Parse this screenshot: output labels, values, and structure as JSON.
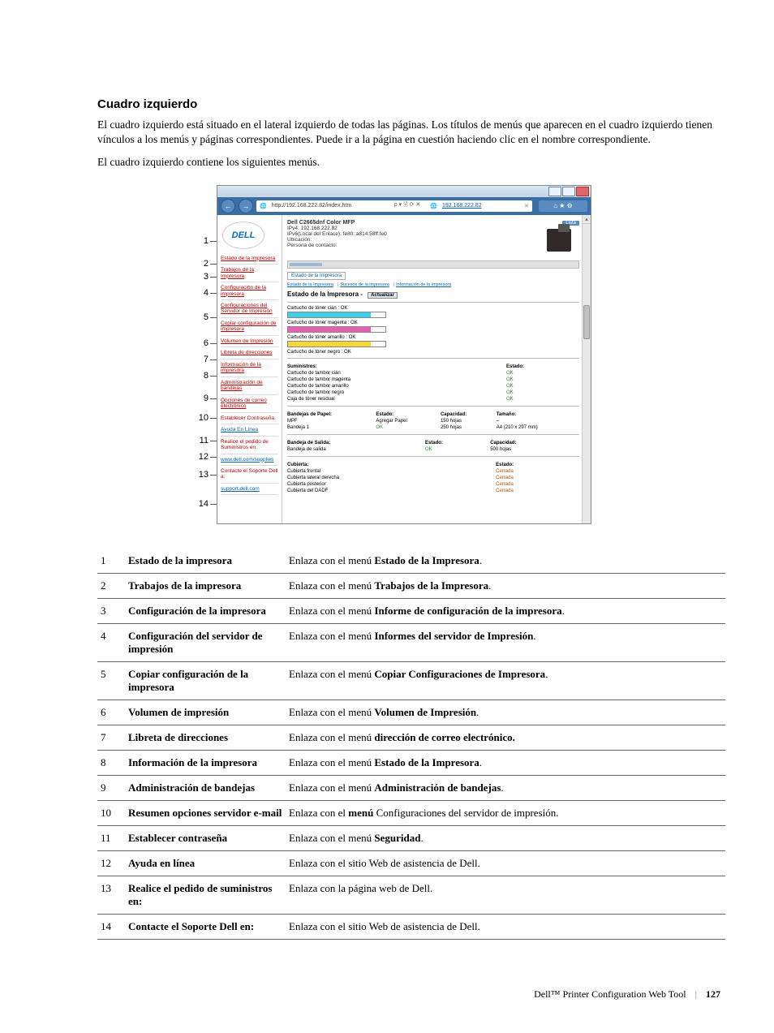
{
  "heading": "Cuadro izquierdo",
  "intro1": "El cuadro izquierdo está situado en el lateral izquierdo de todas las páginas. Los títulos de menús que aparecen en el cuadro izquierdo tienen vínculos a los menús y páginas correspondientes. Puede ir a la página en cuestión haciendo clic en el nombre correspondiente.",
  "intro2": "El cuadro izquierdo contiene los siguientes menús.",
  "callouts": [
    "1",
    "2",
    "3",
    "4",
    "5",
    "6",
    "7",
    "8",
    "9",
    "10",
    "11",
    "12",
    "13",
    "14"
  ],
  "browser": {
    "url": "http://192.168.222.82/index.htm",
    "searchhint": "ρ ▾ 🗟 ⟳ ✕",
    "tabtitle": "192.168.222.82",
    "toolbar_icons": "⌂ ★ ⚙"
  },
  "logo": "DELL",
  "sidebar_items": [
    {
      "label": "Estado de la Impresora",
      "cls": "red-link"
    },
    {
      "label": "Trabajos de la Impresora",
      "cls": "red-link"
    },
    {
      "label": "Configuración de la impresora",
      "cls": "red-link"
    },
    {
      "label": "Configuraciones del Servidor de Impresión",
      "cls": "red-link"
    },
    {
      "label": "Copiar configuración de impresora",
      "cls": "red-link"
    },
    {
      "label": "Volumen de Impresión",
      "cls": "red-link"
    },
    {
      "label": "Libreta de direcciones",
      "cls": "red-link"
    },
    {
      "label": "Información de la impresora",
      "cls": "red-link"
    },
    {
      "label": "Administración de bandejas",
      "cls": "red-link"
    },
    {
      "label": "Opciones de correo electrónico",
      "cls": "red-link"
    },
    {
      "label": "Establecer Contraseña",
      "cls": "sb-item"
    },
    {
      "label": "Ayuda En Línea",
      "cls": "blue"
    },
    {
      "label": "Realice el pedido de Suministros en:",
      "cls": "sb-item"
    },
    {
      "label": "www.dell.com/supplies",
      "cls": "blue"
    },
    {
      "label": "Contacte el Soporte Dell a:",
      "cls": "sb-item"
    },
    {
      "label": "support.dell.com",
      "cls": "blue"
    }
  ],
  "device": {
    "model": "Dell C2665dnf Color MFP",
    "ipv4": "IPv4: 192.168.222.82",
    "ipv6": "IPv6(Local del Enlace): fe80::a814:58ff:fe0",
    "loc_label": "Ubicación:",
    "contact_label": "Persona de contacto:",
    "lista": "Lista"
  },
  "tabs": {
    "t1": "Estado de la Impresora"
  },
  "links": {
    "l1": "Estado de la Impresora",
    "l2": "Sucesos de la impresora",
    "l3": "Información de la impresora"
  },
  "status_title": "Estado de la Impresora -",
  "refresh": "Actualizar",
  "toners": {
    "cyan": "Cartucho de tóner cián : OK",
    "magenta": "Cartucho de tóner magenta : OK",
    "yellow": "Cartucho de tóner amarillo : OK",
    "black": "Cartucho de tóner negro : OK"
  },
  "supplies": {
    "hdr": "Suministros:",
    "status_hdr": "Estado:",
    "rows": [
      {
        "name": "Cartucho de tambor cián",
        "status": "OK"
      },
      {
        "name": "Cartucho de tambor magenta",
        "status": "OK"
      },
      {
        "name": "Cartucho de tambor amarillo",
        "status": "OK"
      },
      {
        "name": "Cartucho de tambor negro",
        "status": "OK"
      },
      {
        "name": "Caja de tóner residual",
        "status": "OK"
      }
    ]
  },
  "trays": {
    "hdr": "Bandejas de Papel:",
    "est": "Estado:",
    "cap": "Capacidad:",
    "size": "Tamaño:",
    "rows": [
      {
        "name": "MPF",
        "status": "Agregar Papel",
        "cap": "150 hojas",
        "size": "–"
      },
      {
        "name": "Bandeja 1",
        "status": "OK",
        "cap": "250 hojas",
        "size": "A4 (210 x 297 mm)"
      }
    ]
  },
  "output": {
    "hdr": "Bandeja de Salida:",
    "est": "Estado:",
    "cap": "Capacidad:",
    "rows": [
      {
        "name": "Bandeja de salida",
        "status": "OK",
        "cap": "500 hojas"
      }
    ]
  },
  "covers": {
    "hdr": "Cubierta:",
    "est": "Estado:",
    "rows": [
      {
        "name": "Cubierta frontal",
        "status": "Cerrada"
      },
      {
        "name": "Cubierta lateral derecha",
        "status": "Cerrada"
      },
      {
        "name": "Cubierta posterior",
        "status": "Cerrada"
      },
      {
        "name": "Cubierta del DADF",
        "status": "Cerrada"
      }
    ]
  },
  "def": [
    {
      "n": "1",
      "term": "Estado de la impresora",
      "pre": "Enlaza con el menú ",
      "bold": "Estado de la Impresora",
      "post": "."
    },
    {
      "n": "2",
      "term": "Trabajos de la impresora",
      "pre": "Enlaza con el menú ",
      "bold": "Trabajos de la Impresora",
      "post": "."
    },
    {
      "n": "3",
      "term": "Configuración de la impresora",
      "pre": "Enlaza con el menú ",
      "bold": "Informe de configuración de la impresora",
      "post": "."
    },
    {
      "n": "4",
      "term": "Configuración del servidor de impresión",
      "pre": "Enlaza con el menú ",
      "bold": "Informes del servidor de Impresión",
      "post": "."
    },
    {
      "n": "5",
      "term": "Copiar configuración de la impresora",
      "pre": "Enlaza con el menú ",
      "bold": "Copiar Configuraciones de Impresora",
      "post": "."
    },
    {
      "n": "6",
      "term": "Volumen de impresión",
      "pre": "Enlaza con el menú ",
      "bold": "Volumen de Impresión",
      "post": "."
    },
    {
      "n": "7",
      "term": "Libreta de direcciones",
      "pre": "Enlaza con el menú ",
      "bold": "dirección de correo electrónico.",
      "post": ""
    },
    {
      "n": "8",
      "term": "Información de la impresora",
      "pre": "Enlaza con el menú ",
      "bold": "Estado de la Impresora",
      "post": "."
    },
    {
      "n": "9",
      "term": "Administración de bandejas",
      "pre": "Enlaza con el menú ",
      "bold": "Administración de bandejas",
      "post": "."
    },
    {
      "n": "10",
      "term": "Resumen opciones servidor e-mail",
      "pre": "Enlaza con el ",
      "bold": "menú",
      "post": " Configuraciones del servidor de impresión."
    },
    {
      "n": "11",
      "term": "Establecer contraseña",
      "pre": "Enlaza con el menú ",
      "bold": "Seguridad",
      "post": "."
    },
    {
      "n": "12",
      "term": "Ayuda en línea",
      "pre": "Enlaza con el sitio Web de asistencia de Dell.",
      "bold": "",
      "post": ""
    },
    {
      "n": "13",
      "term": "Realice el pedido de suministros en:",
      "pre": "Enlaza con la página web de Dell.",
      "bold": "",
      "post": ""
    },
    {
      "n": "14",
      "term": "Contacte el Soporte Dell en:",
      "pre": "Enlaza con el sitio Web de asistencia de Dell.",
      "bold": "",
      "post": ""
    }
  ],
  "footer": {
    "title": "Dell™ Printer Configuration Web Tool",
    "page": "127"
  }
}
